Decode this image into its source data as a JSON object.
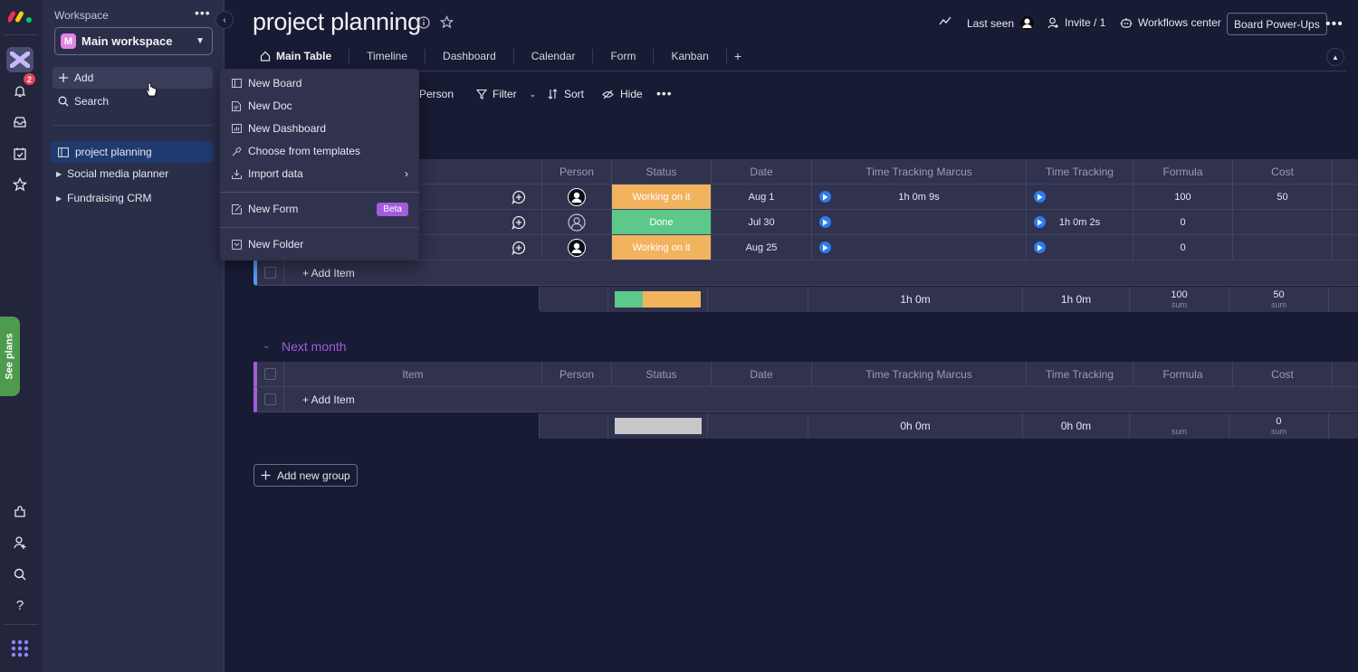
{
  "rail": {
    "notification_count": "2",
    "see_plans_label": "See plans"
  },
  "workspace": {
    "label": "Workspace",
    "selected": "Main workspace",
    "avatar_letter": "M",
    "add_label": "Add",
    "search_label": "Search",
    "boards": [
      {
        "name": "project planning",
        "active": true
      },
      {
        "name": "Social media planner",
        "active": false
      },
      {
        "name": "Fundraising CRM",
        "active": false
      }
    ]
  },
  "add_menu": {
    "items": [
      {
        "label": "New Board",
        "icon": "board-icon"
      },
      {
        "label": "New Doc",
        "icon": "doc-icon"
      },
      {
        "label": "New Dashboard",
        "icon": "dashboard-icon"
      },
      {
        "label": "Choose from templates",
        "icon": "templates-icon"
      },
      {
        "label": "Import data",
        "icon": "import-icon"
      },
      {
        "label": "New Form",
        "icon": "form-icon",
        "badge": "Beta"
      },
      {
        "label": "New Folder",
        "icon": "folder-icon"
      }
    ]
  },
  "header": {
    "title": "project planning",
    "last_seen": "Last seen",
    "invite": "Invite / 1",
    "workflows": "Workflows center",
    "power_ups": "Board Power-Ups"
  },
  "tabs": [
    "Main Table",
    "Timeline",
    "Dashboard",
    "Calendar",
    "Form",
    "Kanban",
    "+"
  ],
  "toolbar": {
    "person": "Person",
    "filter": "Filter",
    "sort": "Sort",
    "hide": "Hide"
  },
  "columns": [
    "Item",
    "Person",
    "Status",
    "Date",
    "Time Tracking Marcus",
    "Time Tracking",
    "Formula",
    "Cost"
  ],
  "groups": [
    {
      "name": "",
      "color": "#579bfc",
      "rows": [
        {
          "person": "filled",
          "status": "Working on it",
          "status_color": "#fdab3d",
          "date": "Aug 1",
          "ttm": "1h 0m 9s",
          "tt": "",
          "formula": "100",
          "cost": "50"
        },
        {
          "person": "empty",
          "status": "Done",
          "status_color": "#00c875",
          "date": "Jul 30",
          "ttm": "",
          "tt": "1h 0m 2s",
          "formula": "0",
          "cost": ""
        },
        {
          "person": "filled",
          "status": "Working on it",
          "status_color": "#fdab3d",
          "date": "Aug 25",
          "ttm": "",
          "tt": "",
          "formula": "0",
          "cost": ""
        }
      ],
      "add_item": "+ Add Item",
      "summary": {
        "status_done_fraction": 0.33,
        "status_working_fraction": 0.67,
        "ttm": "1h 0m",
        "tt": "1h 0m",
        "formula": "100",
        "formula_label": "sum",
        "cost": "50",
        "cost_label": "sum"
      }
    },
    {
      "name": "Next month",
      "color": "#a25ddc",
      "rows": [],
      "add_item": "+ Add Item",
      "summary": {
        "ttm": "0h 0m",
        "tt": "0h 0m",
        "formula": "",
        "formula_label": "sum",
        "cost": "0",
        "cost_label": "sum"
      }
    }
  ],
  "add_group_label": "Add new group"
}
